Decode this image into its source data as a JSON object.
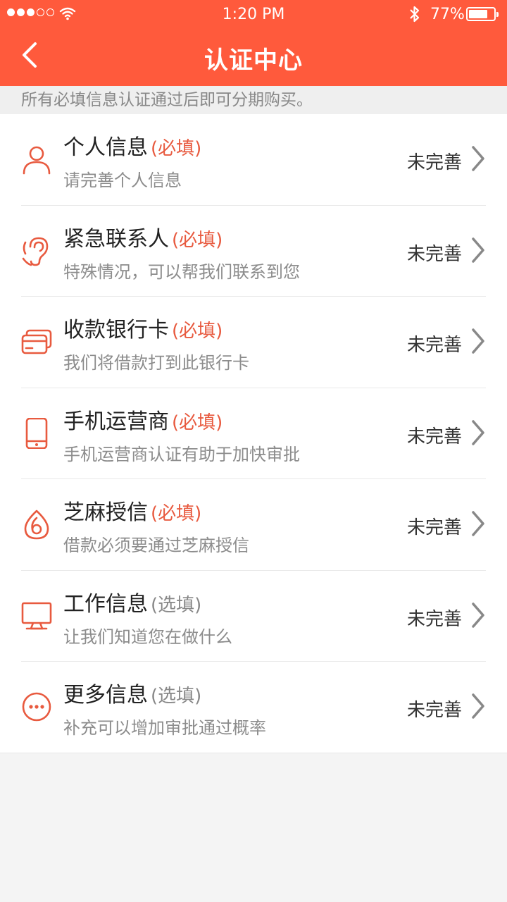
{
  "status_bar": {
    "time": "1:20 PM",
    "battery_text": "77%",
    "battery_level": 0.77,
    "signal_bars_filled": 3,
    "signal_bars_total": 5
  },
  "nav": {
    "title": "认证中心",
    "back_icon": "chevron-left-icon"
  },
  "notice": "所有必填信息认证通过后即可分期购买。",
  "colors": {
    "accent": "#ff5a3c",
    "required_tag": "#e85a3f",
    "icon": "#e85a3f"
  },
  "items": [
    {
      "title": "个人信息",
      "tag": "(必填)",
      "required": true,
      "subtitle": "请完善个人信息",
      "status": "未完善",
      "icon": "person-icon"
    },
    {
      "title": "紧急联系人",
      "tag": "(必填)",
      "required": true,
      "subtitle": "特殊情况，可以帮我们联系到您",
      "status": "未完善",
      "icon": "ear-icon"
    },
    {
      "title": "收款银行卡",
      "tag": "(必填)",
      "required": true,
      "subtitle": "我们将借款打到此银行卡",
      "status": "未完善",
      "icon": "bank-card-icon"
    },
    {
      "title": "手机运营商",
      "tag": "(必填)",
      "required": true,
      "subtitle": "手机运营商认证有助于加快审批",
      "status": "未完善",
      "icon": "phone-icon"
    },
    {
      "title": "芝麻授信",
      "tag": "(必填)",
      "required": true,
      "subtitle": "借款必须要通过芝麻授信",
      "status": "未完善",
      "icon": "sesame-icon"
    },
    {
      "title": "工作信息",
      "tag": "(选填)",
      "required": false,
      "subtitle": "让我们知道您在做什么",
      "status": "未完善",
      "icon": "monitor-icon"
    },
    {
      "title": "更多信息",
      "tag": "(选填)",
      "required": false,
      "subtitle": "补充可以增加审批通过概率",
      "status": "未完善",
      "icon": "more-icon"
    }
  ]
}
